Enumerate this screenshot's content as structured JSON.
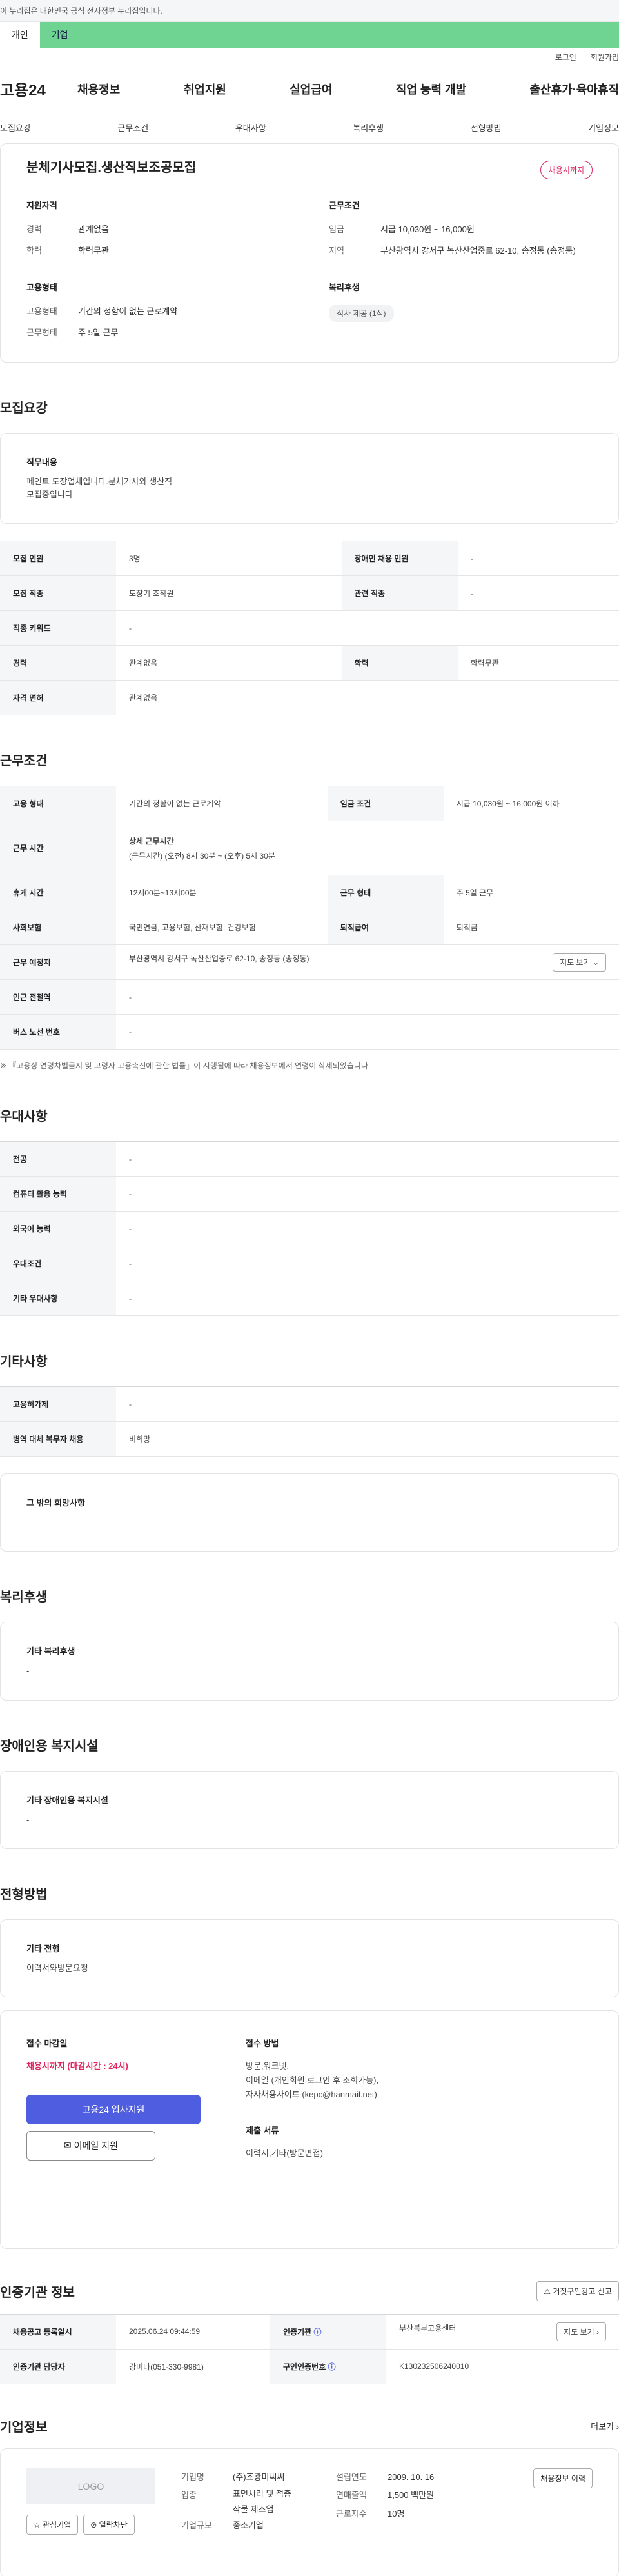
{
  "gov_bar": {
    "text": "이 누리집은 대한민국 공식 전자정부 누리집입니다."
  },
  "tabs": [
    {
      "label": "개인"
    },
    {
      "label": "기업"
    }
  ],
  "util": {
    "login": "로그인",
    "join": "회원가입"
  },
  "gnb": {
    "logo": "고용24",
    "menu": [
      "채용정보",
      "취업지원",
      "실업급여",
      "직업 능력 개발",
      "출산휴가·육아휴직"
    ]
  },
  "subnav": [
    "모집요강",
    "근무조건",
    "우대사항",
    "복리후생",
    "전형방법",
    "기업정보"
  ],
  "summary": {
    "title": "분체기사모집.생산직보조공모집",
    "status": "채용시까지",
    "qual_title": "지원자격",
    "career_label": "경력",
    "career": "관계없음",
    "edu_label": "학력",
    "edu": "학력무관",
    "cond_title": "근무조건",
    "wage_label": "임금",
    "wage": "시급 10,030원 ~ 16,000원",
    "region_label": "지역",
    "region": "부산광역시 강서구 녹산산업중로 62-10, 송정동 (송정동)",
    "emp_title": "고용형태",
    "emp_label": "고용형태",
    "emp": "기간의 정함이 없는 근로계약",
    "worktype_label": "근무형태",
    "worktype": "주 5일 근무",
    "welfare_title": "복리후생",
    "welfare_chip": "식사 제공 (1식)"
  },
  "recruit": {
    "title": "모집요강",
    "duty_title": "직무내용",
    "duty_text": "페인트 도장업체입니다.분체기사와 생산직\n모집중입니다",
    "rows": [
      [
        "모집 인원",
        "3명",
        "장애인 채용 인원",
        "-"
      ],
      [
        "모집 직종",
        "도장기 조작원",
        "관련 직종",
        "-"
      ],
      [
        "직종 키워드",
        "-"
      ],
      [
        "경력",
        "관계없음",
        "학력",
        "학력무관"
      ],
      [
        "자격 면허",
        "관계없음"
      ]
    ]
  },
  "cond": {
    "title": "근무조건",
    "emp_label": "고용 형태",
    "emp": "기간의 정함이 없는 근로계약",
    "wage_label": "임금 조건",
    "wage": "시급 10,030원 ~ 16,000원 이하",
    "time_label": "근무 시간",
    "time_title": "상세 근무시간",
    "time": "(근무시간) (오전) 8시 30분 ~ (오후) 5시 30분",
    "rest_label": "휴게 시간",
    "rest": "12시00분~13시00분",
    "type_label": "근무 형태",
    "type": "주 5일 근무",
    "ins_label": "사회보험",
    "ins": "국민연금, 고용보험, 산재보험, 건강보험",
    "retire_label": "퇴직급여",
    "retire": "퇴직금",
    "place_label": "근무 예정지",
    "place": "부산광역시 강서구 녹산산업중로 62-10, 송정동 (송정동)",
    "map_btn": "지도 보기",
    "subway_label": "인근 전철역",
    "subway": "-",
    "bus_label": "버스 노선 번호",
    "bus": "-",
    "note": "※ 『고용상 연령차별금지 및 고령자 고용촉진에 관한 법률』이 시행됨에 따라 채용정보에서 연령이 삭제되었습니다."
  },
  "pref": {
    "title": "우대사항",
    "rows": [
      [
        "전공",
        "-"
      ],
      [
        "컴퓨터 활용 능력",
        "-"
      ],
      [
        "외국어 능력",
        "-"
      ],
      [
        "우대조건",
        "-"
      ],
      [
        "기타 우대사항",
        "-"
      ]
    ]
  },
  "etc": {
    "title": "기타사항",
    "rows": [
      [
        "고용허가제",
        "-"
      ],
      [
        "병역 대체 복무자 채용",
        "비희망"
      ]
    ],
    "wish_title": "그 밖의 희망사항",
    "wish": "-"
  },
  "welfare": {
    "title": "복리후생",
    "sub": "기타 복리후생",
    "val": "-"
  },
  "disab": {
    "title": "장애인용 복지시설",
    "sub": "기타 장애인용 복지시설",
    "val": "-"
  },
  "select": {
    "title": "전형방법",
    "sub": "기타 전형",
    "val": "이력서와방문요청",
    "deadline_title": "접수 마감일",
    "deadline": "채용시까지 (마감시간 : 24시)",
    "method_title": "접수 방법",
    "method": "방문,워크넷,\n이메일 (개인회원 로그인 후 조회가능),\n자사채용사이트 (kepc@hanmail.net)",
    "docs_title": "제출 서류",
    "docs": "이력서,기타(방문면접)",
    "apply_btn": "고용24 입사지원",
    "email_btn": "이메일 지원"
  },
  "cert": {
    "title": "인증기관 정보",
    "report_btn": "거짓구인광고 신고",
    "reg_label": "채용공고 등록일시",
    "reg": "2025.06.24 09:44:59",
    "org_label": "인증기관",
    "org": "부산북부고용센터",
    "map_btn": "지도 보기",
    "mgr_label": "인증기관 담당자",
    "mgr": "강미나(051-330-9981)",
    "num_label": "구인인증번호",
    "num": "K130232506240010"
  },
  "corp": {
    "title": "기업정보",
    "more": "더보기",
    "logo": "LOGO",
    "fav": "관심기업",
    "block": "열람차단",
    "name_label": "기업명",
    "name": "(주)조광미씨씨",
    "industry_label": "업종",
    "industry": "표면처리 및 적층\n작물 제조업",
    "size_label": "기업규모",
    "size": "중소기업",
    "founded_label": "설립연도",
    "founded": "2009. 10. 16",
    "sales_label": "연매출액",
    "sales": "1,500 백만원",
    "staff_label": "근로자수",
    "staff": "10명",
    "history_btn": "채용정보 이력"
  }
}
